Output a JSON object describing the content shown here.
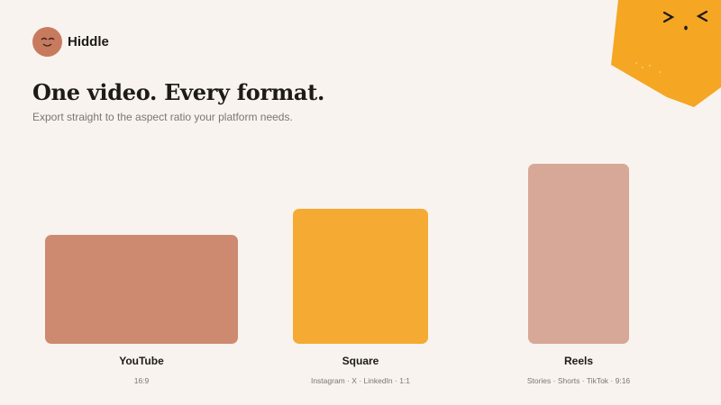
{
  "brand": {
    "name": "Hiddle",
    "logo": "smiling-face-icon"
  },
  "hero": {
    "title": "One video. Every format.",
    "subtitle": "Export straight to the aspect ratio your platform needs."
  },
  "formats": [
    {
      "label": "YouTube",
      "meta": "16:9",
      "color": "#cd8a70"
    },
    {
      "label": "Square",
      "meta": "Instagram · X · LinkedIn · 1:1",
      "color": "#f5aa33"
    },
    {
      "label": "Reels",
      "meta": "Stories · Shorts · TikTok · 9:16",
      "color": "#d7a797"
    }
  ],
  "mascot": {
    "icon": "orange-mascot-icon",
    "color": "#f5a623"
  }
}
